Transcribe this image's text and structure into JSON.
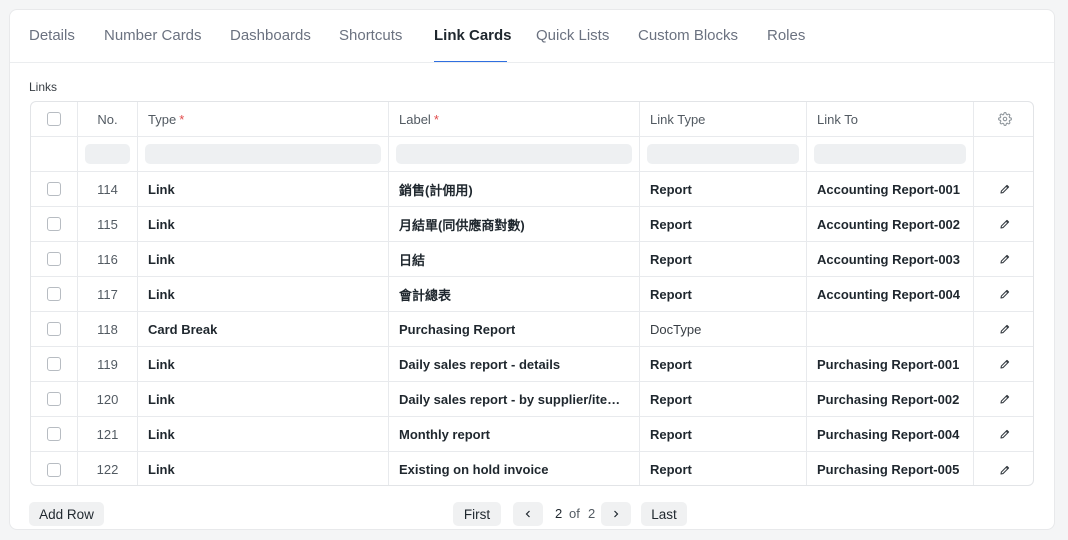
{
  "tabs": [
    "Details",
    "Number Cards",
    "Dashboards",
    "Shortcuts",
    "Link Cards",
    "Quick Lists",
    "Custom Blocks",
    "Roles"
  ],
  "active_tab": "Link Cards",
  "section_label": "Links",
  "columns": {
    "no": "No.",
    "type": "Type",
    "label": "Label",
    "link_type": "Link Type",
    "link_to": "Link To",
    "required_mark": "*",
    "settings_icon": "gear-icon"
  },
  "rows": [
    {
      "no": "114",
      "type": "Link",
      "label": "銷售(計佣用)",
      "link_type": "Report",
      "link_to": "Accounting Report-001"
    },
    {
      "no": "115",
      "type": "Link",
      "label": "月結單(同供應商對數)",
      "link_type": "Report",
      "link_to": "Accounting Report-002"
    },
    {
      "no": "116",
      "type": "Link",
      "label": "日結",
      "link_type": "Report",
      "link_to": "Accounting Report-003"
    },
    {
      "no": "117",
      "type": "Link",
      "label": "會計總表",
      "link_type": "Report",
      "link_to": "Accounting Report-004"
    },
    {
      "no": "118",
      "type": "Card Break",
      "label": "Purchasing Report",
      "link_type": "DocType",
      "link_to": ""
    },
    {
      "no": "119",
      "type": "Link",
      "label": "Daily sales report - details",
      "link_type": "Report",
      "link_to": "Purchasing Report-001"
    },
    {
      "no": "120",
      "type": "Link",
      "label": "Daily sales report - by supplier/item/...",
      "link_type": "Report",
      "link_to": "Purchasing Report-002"
    },
    {
      "no": "121",
      "type": "Link",
      "label": "Monthly report",
      "link_type": "Report",
      "link_to": "Purchasing Report-004"
    },
    {
      "no": "122",
      "type": "Link",
      "label": "Existing on hold invoice",
      "link_type": "Report",
      "link_to": "Purchasing Report-005"
    }
  ],
  "footer": {
    "add_row": "Add Row",
    "first": "First",
    "prev_icon": "chevron-left-icon",
    "next_icon": "chevron-right-icon",
    "current_page": "2",
    "of": "of",
    "total_pages": "2",
    "last": "Last"
  },
  "colors": {
    "accent": "#2f6fe0",
    "required": "#e24c4c"
  }
}
